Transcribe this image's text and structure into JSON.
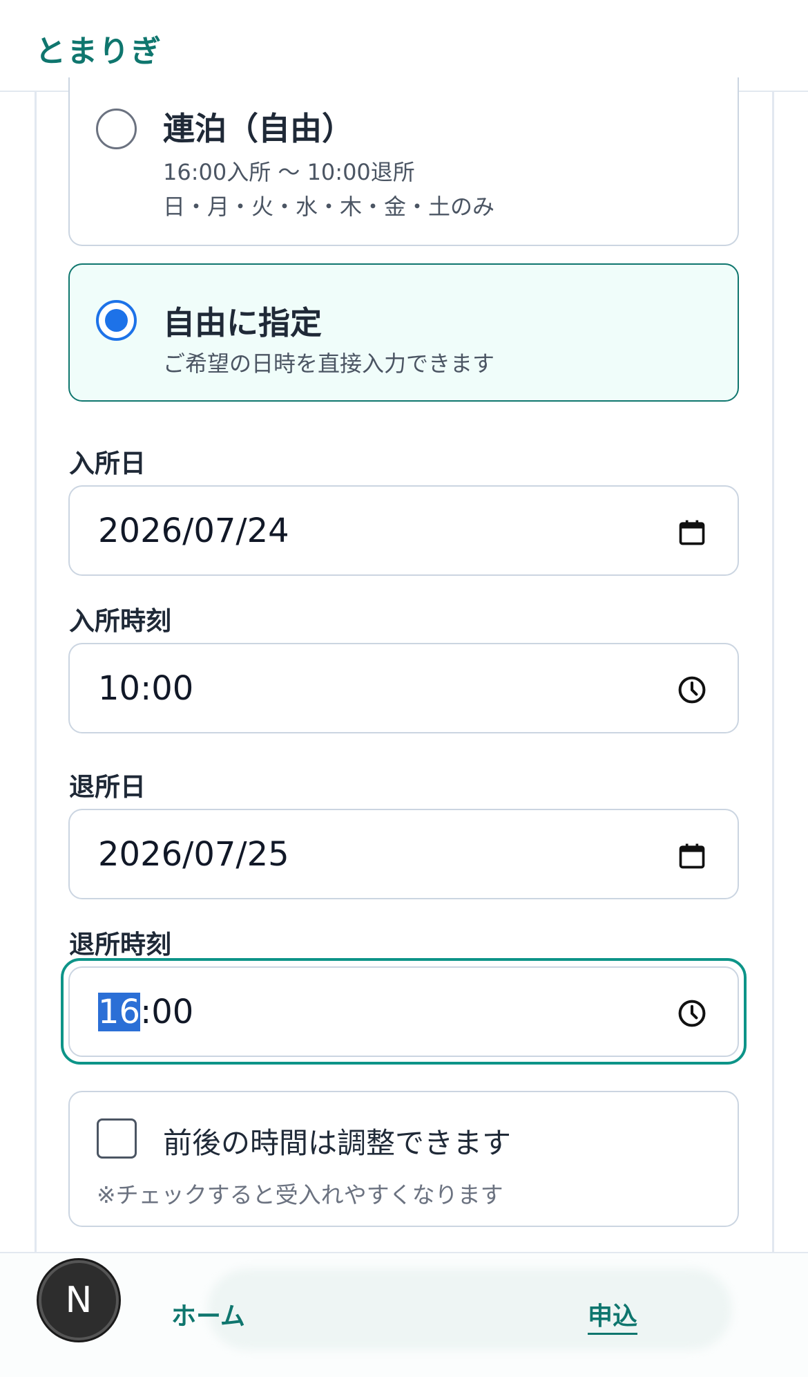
{
  "header": {
    "logo": "とまりぎ"
  },
  "options": [
    {
      "title": "連泊（自由）",
      "line1": "16:00入所 〜 10:00退所",
      "line2": "日・月・火・水・木・金・土のみ",
      "selected": false
    },
    {
      "title": "自由に指定",
      "line1": "ご希望の日時を直接入力できます",
      "selected": true
    }
  ],
  "fields": {
    "checkin_date": {
      "label": "入所日",
      "value": "2026/07/24"
    },
    "checkin_time": {
      "label": "入所時刻",
      "value": "10:00"
    },
    "checkout_date": {
      "label": "退所日",
      "value": "2026/07/25"
    },
    "checkout_time": {
      "label": "退所時刻",
      "value_selected": "16",
      "value_rest": ":00"
    }
  },
  "flexible": {
    "label": "前後の時間は調整できます",
    "note": "※チェックすると受入れやすくなります",
    "checked": false
  },
  "nav": {
    "avatar": "N",
    "home": "ホーム",
    "apply": "申込",
    "active": "apply"
  },
  "colors": {
    "brand": "#0f766e",
    "radio_checked": "#1d72e8",
    "selected_bg": "#f0fdfa",
    "focus_ring": "#0d9488"
  }
}
